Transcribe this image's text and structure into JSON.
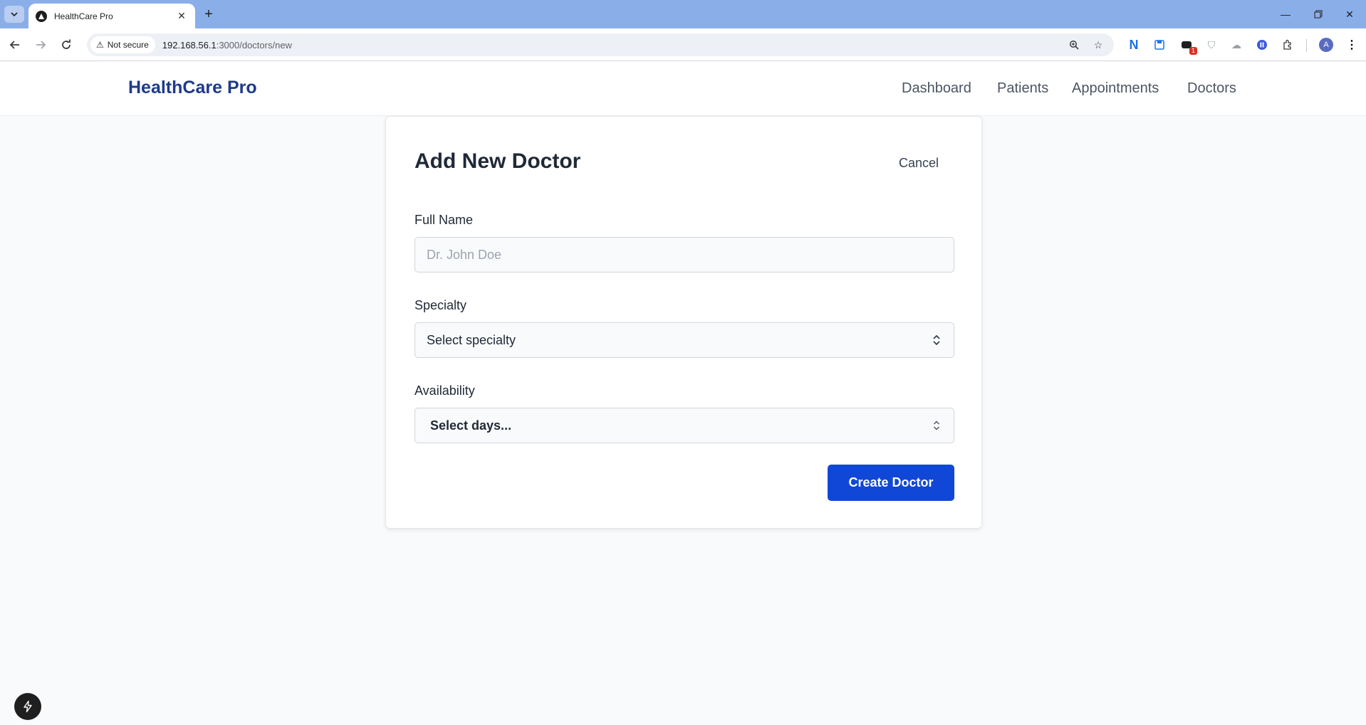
{
  "browser": {
    "tab_title": "HealthCare Pro",
    "security_label": "Not secure",
    "url_host": "192.168.56.1",
    "url_rest": ":3000/doctors/new",
    "profile_initial": "A",
    "extension_badge": "1"
  },
  "header": {
    "brand": "HealthCare Pro",
    "nav": [
      "Dashboard",
      "Patients",
      "Appointments",
      "Doctors"
    ]
  },
  "form": {
    "title": "Add New Doctor",
    "cancel_label": "Cancel",
    "full_name": {
      "label": "Full Name",
      "placeholder": "Dr. John Doe",
      "value": ""
    },
    "specialty": {
      "label": "Specialty",
      "selected": "Select specialty"
    },
    "availability": {
      "label": "Availability",
      "selected": "Select days..."
    },
    "submit_label": "Create Doctor"
  },
  "colors": {
    "brand": "#1e3a8a",
    "primary_button": "#1047d6",
    "tab_strip": "#8aaee8",
    "page_background": "#f8fafc"
  }
}
